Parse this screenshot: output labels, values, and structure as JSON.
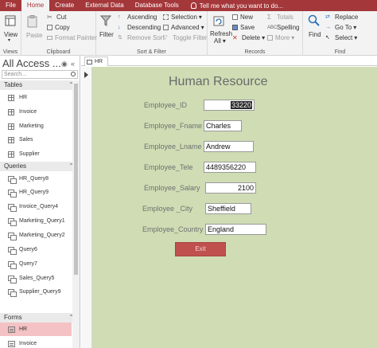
{
  "menu": {
    "tabs": [
      "File",
      "Home",
      "Create",
      "External Data",
      "Database Tools"
    ],
    "active_tab": "Home",
    "tell_me": "Tell me what you want to do..."
  },
  "ribbon": {
    "views": {
      "view_label": "View",
      "group": "Views"
    },
    "clipboard": {
      "paste": "Paste",
      "cut": "Cut",
      "copy": "Copy",
      "format_painter": "Format Painter",
      "group": "Clipboard"
    },
    "sort_filter": {
      "filter": "Filter",
      "ascending": "Ascending",
      "descending": "Descending",
      "remove_sort": "Remove Sort",
      "selection": "Selection",
      "advanced": "Advanced",
      "toggle_filter": "Toggle Filter",
      "group": "Sort & Filter"
    },
    "records": {
      "refresh": "Refresh",
      "refresh_all": "All",
      "new": "New",
      "save": "Save",
      "delete": "Delete",
      "totals": "Totals",
      "spelling": "Spelling",
      "more": "More",
      "group": "Records"
    },
    "find": {
      "find": "Find",
      "replace": "Replace",
      "goto": "Go To",
      "select": "Select",
      "group": "Find"
    }
  },
  "nav": {
    "title": "All Access ...",
    "search_placeholder": "Search...",
    "sections": {
      "tables": "Tables",
      "queries": "Queries",
      "forms": "Forms"
    },
    "tables": [
      "HR",
      "Invoice",
      "Marketing",
      "Sales",
      "Supplier"
    ],
    "queries": [
      "HR_Query8",
      "HR_Query9",
      "Invoice_Query4",
      "Marketing_Query1",
      "Marketing_Query2",
      "Query6",
      "Query7",
      "Sales_Query5",
      "Supplier_Query9"
    ],
    "forms": [
      "HR",
      "Invoice"
    ],
    "selected_form": "HR"
  },
  "document": {
    "tab_label": "HR"
  },
  "form": {
    "title": "Human Resource",
    "fields": [
      {
        "label": "Employee_ID",
        "value": "33220"
      },
      {
        "label": "Employee_Fname",
        "value": "Charles"
      },
      {
        "label": "Employee_Lname",
        "value": "Andrew"
      },
      {
        "label": "Employee_Tele",
        "value": "4489356220"
      },
      {
        "label": "Employee_Salary",
        "value": "2100"
      },
      {
        "label": "Employee _City",
        "value": "Sheffield"
      },
      {
        "label": "Employee_Country",
        "value": "England"
      }
    ],
    "exit_label": "Exit"
  },
  "colors": {
    "title_bar": "#a4373a",
    "form_background": "#cfdcb4",
    "exit_button": "#c0504d",
    "selected_nav": "#f4c2c4"
  }
}
